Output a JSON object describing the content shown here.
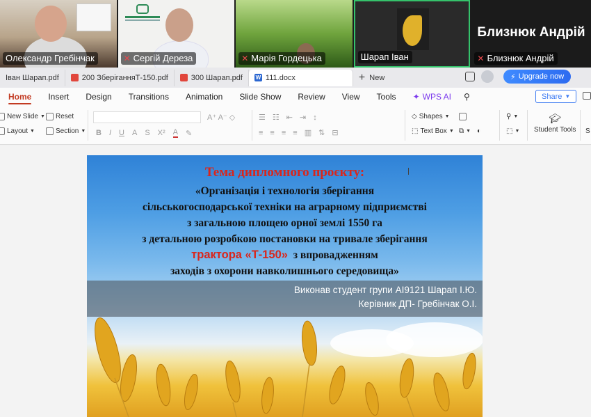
{
  "video_tiles": [
    {
      "name": "Олександр Гребінчак",
      "muted": false
    },
    {
      "name": "Сергій Дереза",
      "muted": true
    },
    {
      "name": "Марія Гордецька",
      "muted": true
    },
    {
      "name": "Шарап Іван",
      "muted": false
    },
    {
      "name": "Близнюк Андрій",
      "display_name": "Близнюк Андрій",
      "muted": true
    }
  ],
  "tabs": [
    {
      "label": "Іван Шарап.pdf",
      "type": "pdf"
    },
    {
      "label": "200 ЗберіганняТ-150.pdf",
      "type": "pdf"
    },
    {
      "label": "300 Шарап.pdf",
      "type": "pdf"
    },
    {
      "label": "111.docx",
      "type": "docx"
    }
  ],
  "new_tab_label": "New",
  "upgrade_label": "Upgrade now",
  "menu": {
    "items": [
      "Home",
      "Insert",
      "Design",
      "Transitions",
      "Animation",
      "Slide Show",
      "Review",
      "View",
      "Tools"
    ],
    "active": "Home",
    "wps_ai": "WPS AI",
    "share": "Share"
  },
  "ribbon": {
    "new_slide": "New Slide",
    "reset": "Reset",
    "layout": "Layout",
    "section": "Section",
    "shapes": "Shapes",
    "text_box": "Text Box",
    "student_tools": "Student Tools"
  },
  "slide": {
    "title": "Тема дипломного проєкту:",
    "line1": "«Організація і технологія зберігання",
    "line2": "сільськогосподарської техніки на аграрному підприємстві",
    "line3": "з загальною площею орної землі 1550 га",
    "line4": "з детальною розробкою постановки на тривале зберігання",
    "line5_red": "трактора «Т-150»",
    "line5_rest": "з впровадженням",
    "line6": "заходів з охорони  навколишнього середовища»",
    "author": "Виконав студент групи АІ9121 Шарап І.Ю.",
    "supervisor": "Керівник ДП- Гребінчак О.І."
  }
}
